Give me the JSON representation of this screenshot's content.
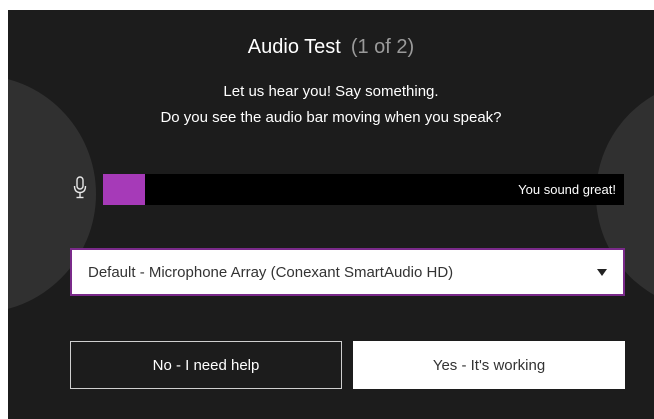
{
  "dialog": {
    "title": "Audio Test",
    "step": "(1 of 2)",
    "instruction_line1": "Let us hear you! Say something.",
    "instruction_line2": "Do you see the audio bar moving when you speak?"
  },
  "audio_meter": {
    "level": 0.08,
    "status_text": "You sound great!",
    "fill_color": "#a63ab8"
  },
  "microphone_select": {
    "selected_value": "Default - Microphone Array (Conexant SmartAudio HD)"
  },
  "buttons": {
    "no_label": "No - I need help",
    "yes_label": "Yes - It's working"
  },
  "icons": {
    "mic": "microphone-icon",
    "dropdown": "chevron-down-icon"
  },
  "colors": {
    "background": "#1c1c1c",
    "accent": "#a63ab8",
    "select_border": "#7a2a8a"
  }
}
